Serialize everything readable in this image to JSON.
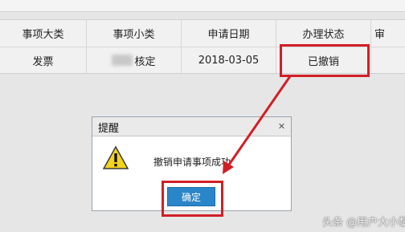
{
  "table": {
    "headers": [
      "事项大类",
      "事项小类",
      "申请日期",
      "办理状态",
      "审"
    ],
    "row": {
      "category": "发票",
      "subcategory": "核定",
      "date": "2018-03-05",
      "status": "已撤销"
    }
  },
  "dialog": {
    "title": "提醒",
    "message": "撤销申请事项成功",
    "ok_label": "确定",
    "close_icon": "close-icon",
    "warning_icon": "warning-icon"
  },
  "annotation": {
    "color": "#d21f26"
  },
  "watermark": "头条 @用户大小黎"
}
